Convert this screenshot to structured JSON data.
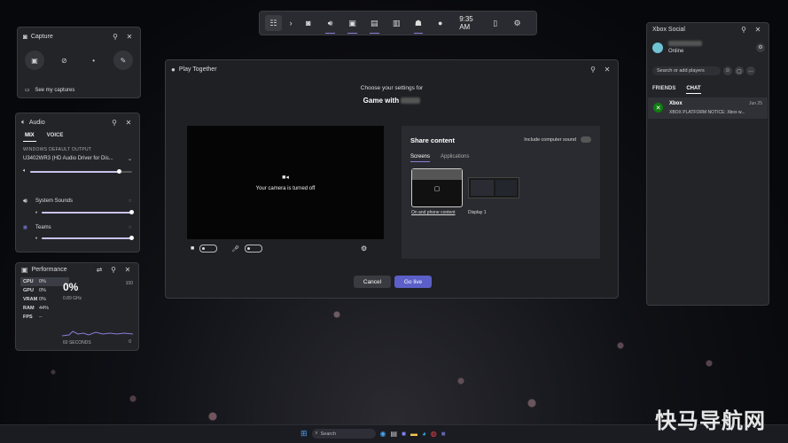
{
  "topbar": {
    "time": "9:35 AM",
    "widgets": [
      "widget-menu",
      "capture",
      "audio",
      "performance",
      "resources",
      "xbox-social",
      "achievements",
      "play-together"
    ]
  },
  "capture": {
    "title": "Capture",
    "see_captures": "See my captures"
  },
  "audio": {
    "title": "Audio",
    "tabs": [
      "MIX",
      "VOICE"
    ],
    "default_output_label": "WINDOWS DEFAULT OUTPUT",
    "device": "U3402WR3 (HD Audio Driver for Dis...",
    "master_level": 0.88,
    "apps": [
      {
        "name": "System Sounds",
        "level": 1.0
      },
      {
        "name": "Teams",
        "level": 1.0
      }
    ]
  },
  "performance": {
    "title": "Performance",
    "items": [
      {
        "name": "CPU",
        "value": "0%"
      },
      {
        "name": "GPU",
        "value": "0%"
      },
      {
        "name": "VRAM",
        "value": "0%"
      },
      {
        "name": "RAM",
        "value": "44%"
      },
      {
        "name": "FPS",
        "value": "--"
      }
    ],
    "big_value": "0%",
    "freq": "0.89 GHz",
    "max_label": "100",
    "min_label": "0",
    "time_label": "60 SECONDS"
  },
  "play_together": {
    "title": "Play Together",
    "subtitle": "Choose your settings for",
    "heading": "Game with",
    "camera_off": "Your camera is turned off",
    "share_title": "Share content",
    "include_sound": "Include computer sound",
    "tabs": [
      "Screens",
      "Applications"
    ],
    "thumbs": [
      "On and phone content",
      "Display 1"
    ],
    "cancel": "Cancel",
    "go_live": "Go live"
  },
  "social": {
    "title": "Xbox Social",
    "status": "Online",
    "search_placeholder": "Search or add players",
    "tabs": [
      "FRIENDS",
      "CHAT"
    ],
    "chat": {
      "name": "Xbox",
      "date": "Jun 25",
      "message": "XBOX PLATFORM NOTICE: Xbox w..."
    }
  },
  "taskbar": {
    "search_placeholder": "Search"
  },
  "watermark": "快马导航网",
  "colors": {
    "accent": "#5b5fc7",
    "slider": "#c9c2ea",
    "xbox_green": "#107c10"
  }
}
